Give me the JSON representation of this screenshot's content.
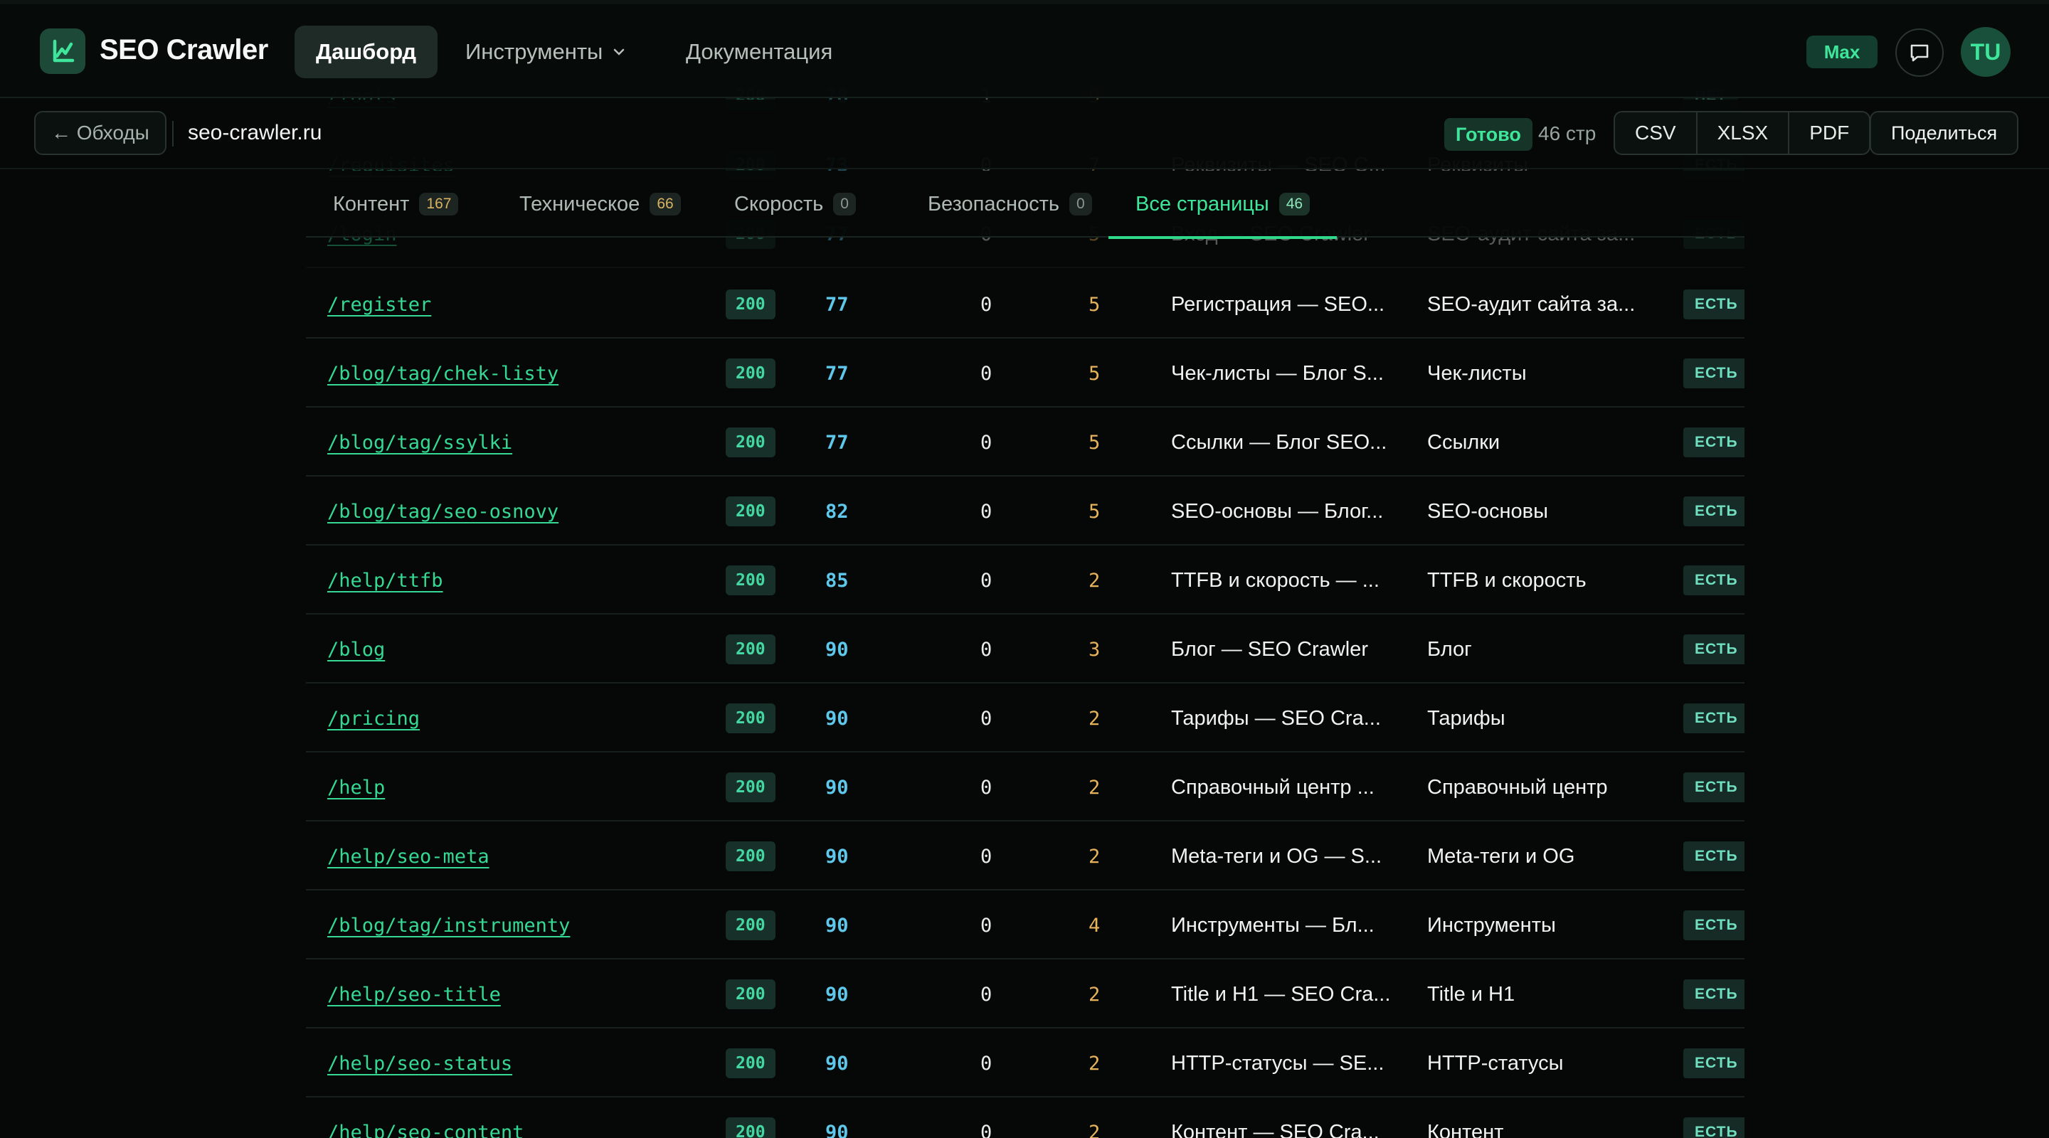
{
  "nav": {
    "brand": "SEO Crawler",
    "items": [
      {
        "label": "Дашборд",
        "active": true
      },
      {
        "label": "Инструменты",
        "dropdown": true
      },
      {
        "label": "Документация"
      }
    ],
    "plan": "Max",
    "avatar": "TU",
    "accent": "#3ee59a"
  },
  "subbar": {
    "back": "← Обходы",
    "domain": "seo-crawler.ru",
    "status": "Готово",
    "pages": "46 стр",
    "exports": [
      "CSV",
      "XLSX",
      "PDF"
    ],
    "share": "Поделиться"
  },
  "tabs": [
    {
      "label": "Контент",
      "count": "167"
    },
    {
      "label": "Техническое",
      "count": "66"
    },
    {
      "label": "Скорость",
      "count": "0"
    },
    {
      "label": "Безопасность",
      "count": "0"
    },
    {
      "label": "Все страницы",
      "count": "46",
      "active": true
    }
  ],
  "ghost_rows": [
    {
      "url": "/tools",
      "code": "200",
      "score": "78",
      "a": "1",
      "b": "9",
      "title": "",
      "h1": "",
      "og": "НЕТ"
    },
    {
      "url": "/requisites",
      "code": "200",
      "score": "73",
      "a": "0",
      "b": "7",
      "title": "Реквизиты — SEO C...",
      "h1": "Реквизиты",
      "og": "ЕСТЬ"
    },
    {
      "url": "/login",
      "code": "200",
      "score": "77",
      "a": "0",
      "b": "5",
      "title": "Вход — SEO Crawler",
      "h1": "SEO-аудит сайта за...",
      "og": "ЕСТЬ"
    }
  ],
  "rows": [
    {
      "url": "/register",
      "code": "200",
      "score": "77",
      "a": "0",
      "b": "5",
      "title": "Регистрация — SEO...",
      "h1": "SEO-аудит сайта за...",
      "og": "ЕСТЬ"
    },
    {
      "url": "/blog/tag/chek-listy",
      "code": "200",
      "score": "77",
      "a": "0",
      "b": "5",
      "title": "Чек-листы — Блог S...",
      "h1": "Чек-листы",
      "og": "ЕСТЬ"
    },
    {
      "url": "/blog/tag/ssylki",
      "code": "200",
      "score": "77",
      "a": "0",
      "b": "5",
      "title": "Ссылки — Блог SEO...",
      "h1": "Ссылки",
      "og": "ЕСТЬ"
    },
    {
      "url": "/blog/tag/seo-osnovy",
      "code": "200",
      "score": "82",
      "a": "0",
      "b": "5",
      "title": "SEO-основы — Блог...",
      "h1": "SEO-основы",
      "og": "ЕСТЬ"
    },
    {
      "url": "/help/ttfb",
      "code": "200",
      "score": "85",
      "a": "0",
      "b": "2",
      "title": "TTFB и скорость — ...",
      "h1": "TTFB и скорость",
      "og": "ЕСТЬ"
    },
    {
      "url": "/blog",
      "code": "200",
      "score": "90",
      "a": "0",
      "b": "3",
      "title": "Блог — SEO Crawler",
      "h1": "Блог",
      "og": "ЕСТЬ"
    },
    {
      "url": "/pricing",
      "code": "200",
      "score": "90",
      "a": "0",
      "b": "2",
      "title": "Тарифы — SEO Cra...",
      "h1": "Тарифы",
      "og": "ЕСТЬ"
    },
    {
      "url": "/help",
      "code": "200",
      "score": "90",
      "a": "0",
      "b": "2",
      "title": "Справочный центр ...",
      "h1": "Справочный центр",
      "og": "ЕСТЬ"
    },
    {
      "url": "/help/seo-meta",
      "code": "200",
      "score": "90",
      "a": "0",
      "b": "2",
      "title": "Meta-теги и OG — S...",
      "h1": "Meta-теги и OG",
      "og": "ЕСТЬ"
    },
    {
      "url": "/blog/tag/instrumenty",
      "code": "200",
      "score": "90",
      "a": "0",
      "b": "4",
      "title": "Инструменты — Бл...",
      "h1": "Инструменты",
      "og": "ЕСТЬ"
    },
    {
      "url": "/help/seo-title",
      "code": "200",
      "score": "90",
      "a": "0",
      "b": "2",
      "title": "Title и H1 — SEO Cra...",
      "h1": "Title и H1",
      "og": "ЕСТЬ"
    },
    {
      "url": "/help/seo-status",
      "code": "200",
      "score": "90",
      "a": "0",
      "b": "2",
      "title": "HTTP-статусы — SE...",
      "h1": "HTTP-статусы",
      "og": "ЕСТЬ"
    },
    {
      "url": "/help/seo-content",
      "code": "200",
      "score": "90",
      "a": "0",
      "b": "2",
      "title": "Контент — SEO Cra...",
      "h1": "Контент",
      "og": "ЕСТЬ"
    }
  ]
}
